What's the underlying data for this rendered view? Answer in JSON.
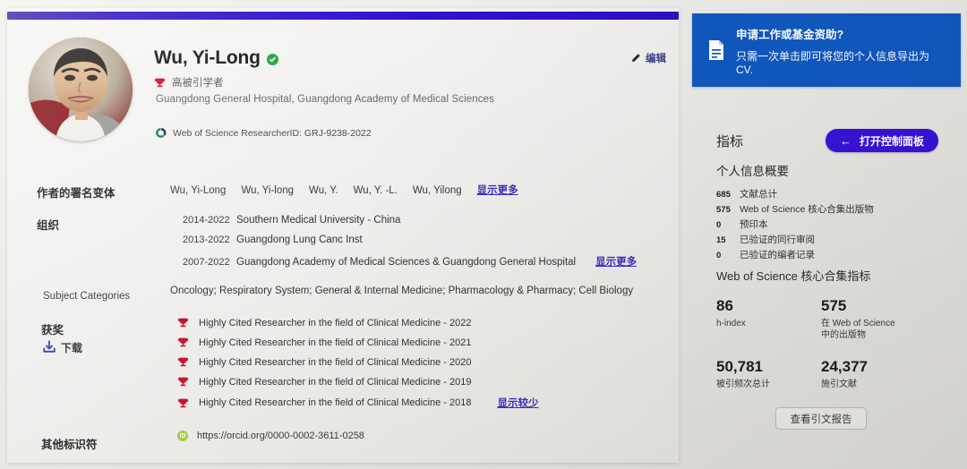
{
  "colors": {
    "accent_purple": "#3a12d8",
    "banner_blue": "#1059c0",
    "link_purple": "#3c2fbf",
    "verified_green": "#27a343",
    "orcid_green": "#a6ce39",
    "trophy_red": "#c8102e"
  },
  "profile": {
    "name": "Wu, Yi-Long",
    "verified_icon": "verified-check-icon",
    "badge_icon": "trophy-icon",
    "badge_label": "高被引学者",
    "affiliation": "Guangdong General Hospital, Guangdong Academy of Medical Sciences",
    "researcher_id_icon": "web-of-science-icon",
    "researcher_id": "Web of Science ResearcherID: GRJ-9238-2022",
    "edit_icon": "pencil-icon",
    "edit_label": "编辑"
  },
  "fields": {
    "name_variants_label": "作者的署名变体",
    "name_variants": [
      "Wu, Yi-Long",
      "Wu, Yi-long",
      "Wu, Y.",
      "Wu, Y. -L.",
      "Wu, Yilong"
    ],
    "name_variants_more": "显示更多",
    "organizations_label": "组织",
    "organizations": [
      {
        "years": "2014-2022",
        "name": "Southern Medical University - China"
      },
      {
        "years": "2013-2022",
        "name": "Guangdong Lung Canc Inst"
      },
      {
        "years": "2007-2022",
        "name": "Guangdong Academy of Medical Sciences & Guangdong General Hospital"
      }
    ],
    "organizations_more": "显示更多",
    "subject_categories_label": "Subject Categories",
    "subject_categories": "Oncology;  Respiratory System;  General & Internal Medicine;  Pharmacology & Pharmacy;  Cell Biology",
    "awards_label": "获奖",
    "download_icon": "download-icon",
    "download_label": "下载",
    "awards": [
      "Highly Cited Researcher in the field of Clinical Medicine - 2022",
      "Highly Cited Researcher in the field of Clinical Medicine - 2021",
      "Highly Cited Researcher in the field of Clinical Medicine - 2020",
      "Highly Cited Researcher in the field of Clinical Medicine - 2019",
      "Highly Cited Researcher in the field of Clinical Medicine - 2018"
    ],
    "awards_less": "显示较少",
    "other_identifiers_label": "其他标识符",
    "orcid_icon": "orcid-icon",
    "orcid_url": "https://orcid.org/0000-0002-3611-0258"
  },
  "cv_banner": {
    "icon": "document-icon",
    "line1": "申请工作或基金资助?",
    "line2": "只需一次单击即可将您的个人信息导出为 CV."
  },
  "metrics": {
    "title": "指标",
    "dashboard_button": {
      "icon": "arrow-left-icon",
      "label": "打开控制面板"
    },
    "summary_title": "个人信息概要",
    "summary_rows": [
      {
        "count": "685",
        "label": "文献总计"
      },
      {
        "count": "575",
        "label": "Web of Science 核心合集出版物"
      },
      {
        "count": "0",
        "label": "预印本"
      },
      {
        "count": "15",
        "label": "已验证的同行审阅"
      },
      {
        "count": "0",
        "label": "已验证的编者记录"
      }
    ],
    "core_title": "Web of Science 核心合集指标",
    "stats": [
      {
        "value": "86",
        "label": "h-index",
        "label2": ""
      },
      {
        "value": "575",
        "label": "在 Web of Science",
        "label2": "中的出版物"
      },
      {
        "value": "50,781",
        "label": "被引频次总计",
        "label2": ""
      },
      {
        "value": "24,377",
        "label": "施引文献",
        "label2": ""
      }
    ],
    "citation_report_button": "查看引文报告"
  }
}
